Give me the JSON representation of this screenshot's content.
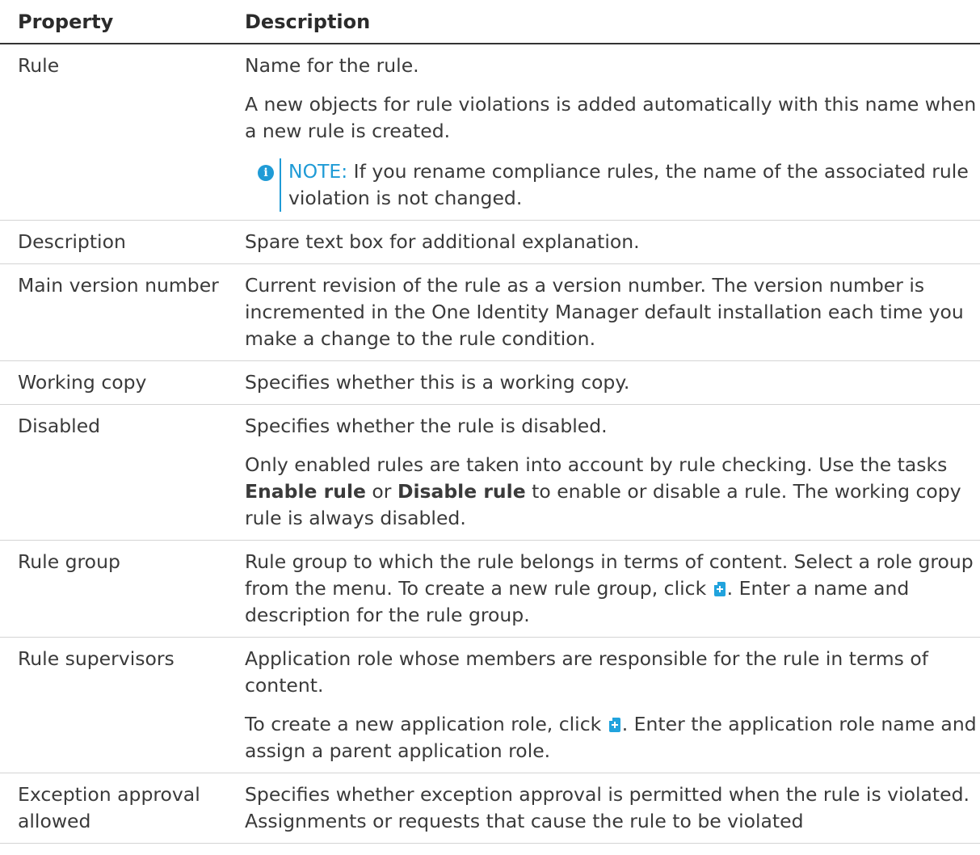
{
  "table": {
    "headers": {
      "property": "Property",
      "description": "Description"
    },
    "rows": [
      {
        "property": "Rule",
        "p1": "Name for the rule.",
        "p2": "A new objects for rule violations is added automatically with this name when a new rule is created.",
        "note_label": "NOTE:",
        "note_text": " If you rename compliance rules, the name of the associated rule violation is not changed."
      },
      {
        "property": "Description",
        "p1": "Spare text box for additional explanation."
      },
      {
        "property": "Main version number",
        "p1": "Current revision of the rule as a version number. The version number is incremented in the One Identity Manager default installation each time you make a change to the rule condition."
      },
      {
        "property": "Working copy",
        "p1": "Specifies whether this is a working copy."
      },
      {
        "property": "Disabled",
        "p1": "Specifies whether the rule is disabled.",
        "p2_a": "Only enabled rules are taken into account by rule checking. Use the tasks ",
        "p2_b1": "Enable rule",
        "p2_mid": " or ",
        "p2_b2": "Disable rule",
        "p2_c": "  to enable or disable a rule. The working copy rule is always disabled."
      },
      {
        "property": "Rule group",
        "p1_a": "Rule group to which the rule belongs in terms of content. Select a role group from the menu. To create a new rule group, click ",
        "p1_b": ". Enter a name and description for the rule group."
      },
      {
        "property": "Rule supervisors",
        "p1": "Application role whose members are responsible for the rule in terms of content.",
        "p2_a": "To create a new application role, click ",
        "p2_b": ". Enter the application role name and assign a parent application role."
      },
      {
        "property": "Exception approval allowed",
        "p1": "Specifies whether exception approval is permitted when the rule is violated. Assignments or requests that cause the rule to be violated"
      }
    ]
  },
  "icons": {
    "info": "info-icon",
    "add": "add-icon"
  },
  "colors": {
    "accent": "#1f9bd6",
    "text": "#3a3a3a"
  }
}
